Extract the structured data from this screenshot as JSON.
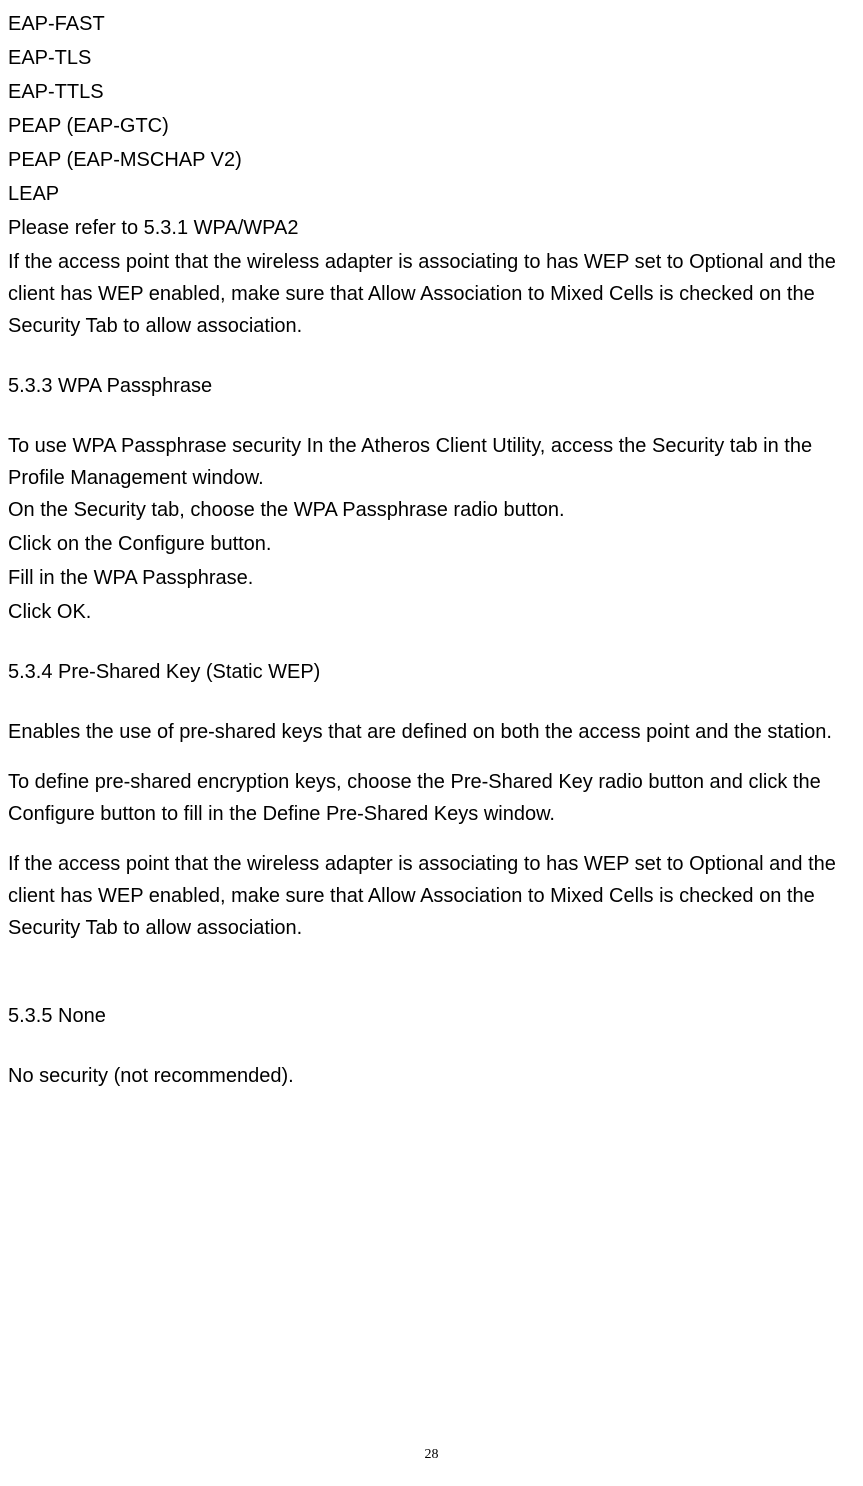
{
  "lines": {
    "l1": "EAP-FAST",
    "l2": "EAP-TLS",
    "l3": "EAP-TTLS",
    "l4": "PEAP (EAP-GTC)",
    "l5": "PEAP (EAP-MSCHAP V2)",
    "l6": "LEAP",
    "l7": "Please refer to 5.3.1 WPA/WPA2",
    "l8": "If the access point that the wireless adapter is associating to has WEP set to Optional and the client has WEP enabled, make sure that Allow Association to Mixed Cells is checked on the Security Tab to allow association."
  },
  "section533": {
    "heading": "5.3.3 WPA Passphrase",
    "p1": "To use WPA Passphrase security In the Atheros Client Utility, access the Security tab in the Profile Management window.",
    "p2": "On the Security tab, choose the WPA Passphrase radio button.",
    "p3": "Click on the Configure button.",
    "p4": "Fill in the WPA Passphrase.",
    "p5": "Click OK."
  },
  "section534": {
    "heading": "5.3.4    Pre-Shared Key (Static WEP)",
    "p1": "Enables the use of pre-shared keys that are defined on both the access point and the station.",
    "p2": "To define pre-shared encryption keys, choose the Pre-Shared Key radio button and click the Configure button to fill in the Define Pre-Shared Keys window.",
    "p3": "If the access point that the wireless adapter is associating to has WEP set to Optional and the client has WEP enabled, make sure that Allow Association to Mixed Cells is checked on the Security Tab to allow association."
  },
  "section535": {
    "heading": "5.3.5    None",
    "p1": "No security (not recommended)."
  },
  "pageNumber": "28"
}
